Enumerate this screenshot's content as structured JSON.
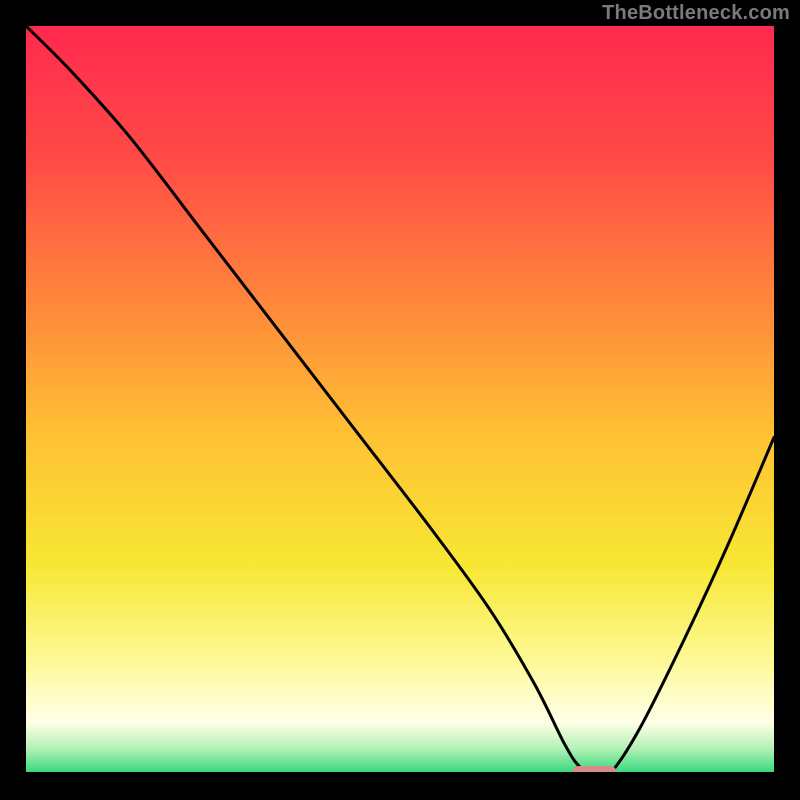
{
  "watermark": "TheBottleneck.com",
  "chart_data": {
    "type": "line",
    "title": "",
    "xlabel": "",
    "ylabel": "",
    "xlim": [
      0,
      100
    ],
    "ylim": [
      0,
      100
    ],
    "grid": false,
    "legend": false,
    "series": [
      {
        "name": "bottleneck-curve",
        "x": [
          0,
          6,
          14,
          24,
          34,
          44,
          54,
          62,
          68,
          72,
          74,
          76,
          78,
          82,
          88,
          94,
          100
        ],
        "values": [
          100,
          94,
          85,
          72,
          59,
          46,
          33,
          22,
          12,
          4,
          1,
          0,
          0,
          6,
          18,
          31,
          45
        ]
      }
    ],
    "marker": {
      "name": "optimal-range",
      "x_range": [
        73,
        79
      ],
      "y": 0,
      "color": "#d88a8a"
    },
    "gradient_stops": [
      {
        "offset": 0.0,
        "color": "#ff294e"
      },
      {
        "offset": 0.18,
        "color": "#ff4b46"
      },
      {
        "offset": 0.38,
        "color": "#ff8a3a"
      },
      {
        "offset": 0.55,
        "color": "#ffc234"
      },
      {
        "offset": 0.72,
        "color": "#f7e733"
      },
      {
        "offset": 0.85,
        "color": "#fdf996"
      },
      {
        "offset": 0.93,
        "color": "#ffffe8"
      },
      {
        "offset": 0.965,
        "color": "#b6f2b6"
      },
      {
        "offset": 1.0,
        "color": "#2fd67a"
      }
    ]
  }
}
